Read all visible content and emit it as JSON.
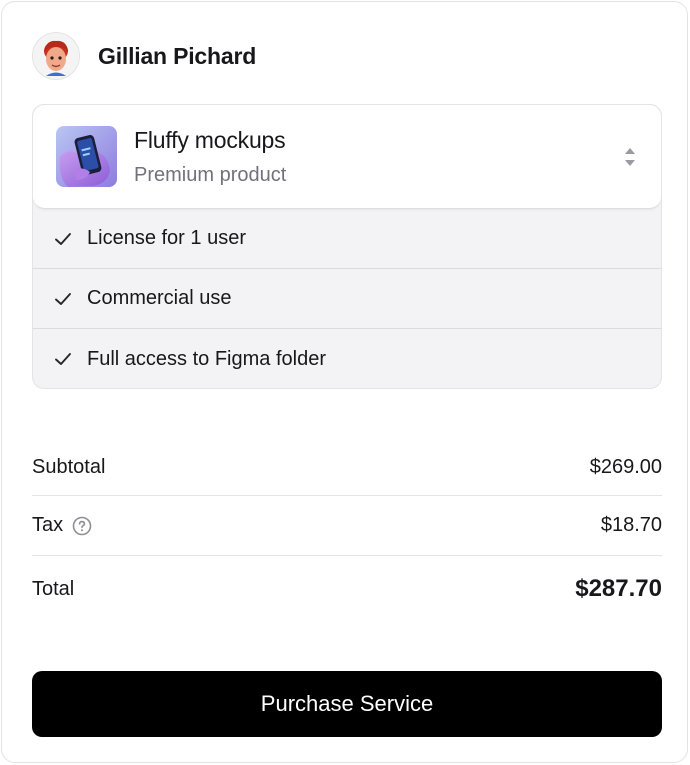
{
  "user": {
    "name": "Gillian Pichard",
    "avatar_icon": "memoji-avatar"
  },
  "product": {
    "title": "Fluffy mockups",
    "subtitle": "Premium product",
    "thumbnail_icon": "phone-mockup-thumbnail",
    "selector_icon": "chevron-up-down-icon",
    "features": [
      {
        "label": "License for 1 user",
        "icon": "check-icon"
      },
      {
        "label": "Commercial use",
        "icon": "check-icon"
      },
      {
        "label": "Full access to Figma folder",
        "icon": "check-icon"
      }
    ]
  },
  "summary": {
    "subtotal_label": "Subtotal",
    "subtotal_value": "$269.00",
    "tax_label": "Tax",
    "tax_value": "$18.70",
    "tax_help_icon": "question-circle-icon",
    "total_label": "Total",
    "total_value": "$287.70"
  },
  "actions": {
    "purchase_label": "Purchase Service"
  },
  "colors": {
    "button_bg": "#000000",
    "button_text": "#ffffff",
    "muted_text": "#71717a",
    "feature_bg": "#f3f3f5"
  }
}
